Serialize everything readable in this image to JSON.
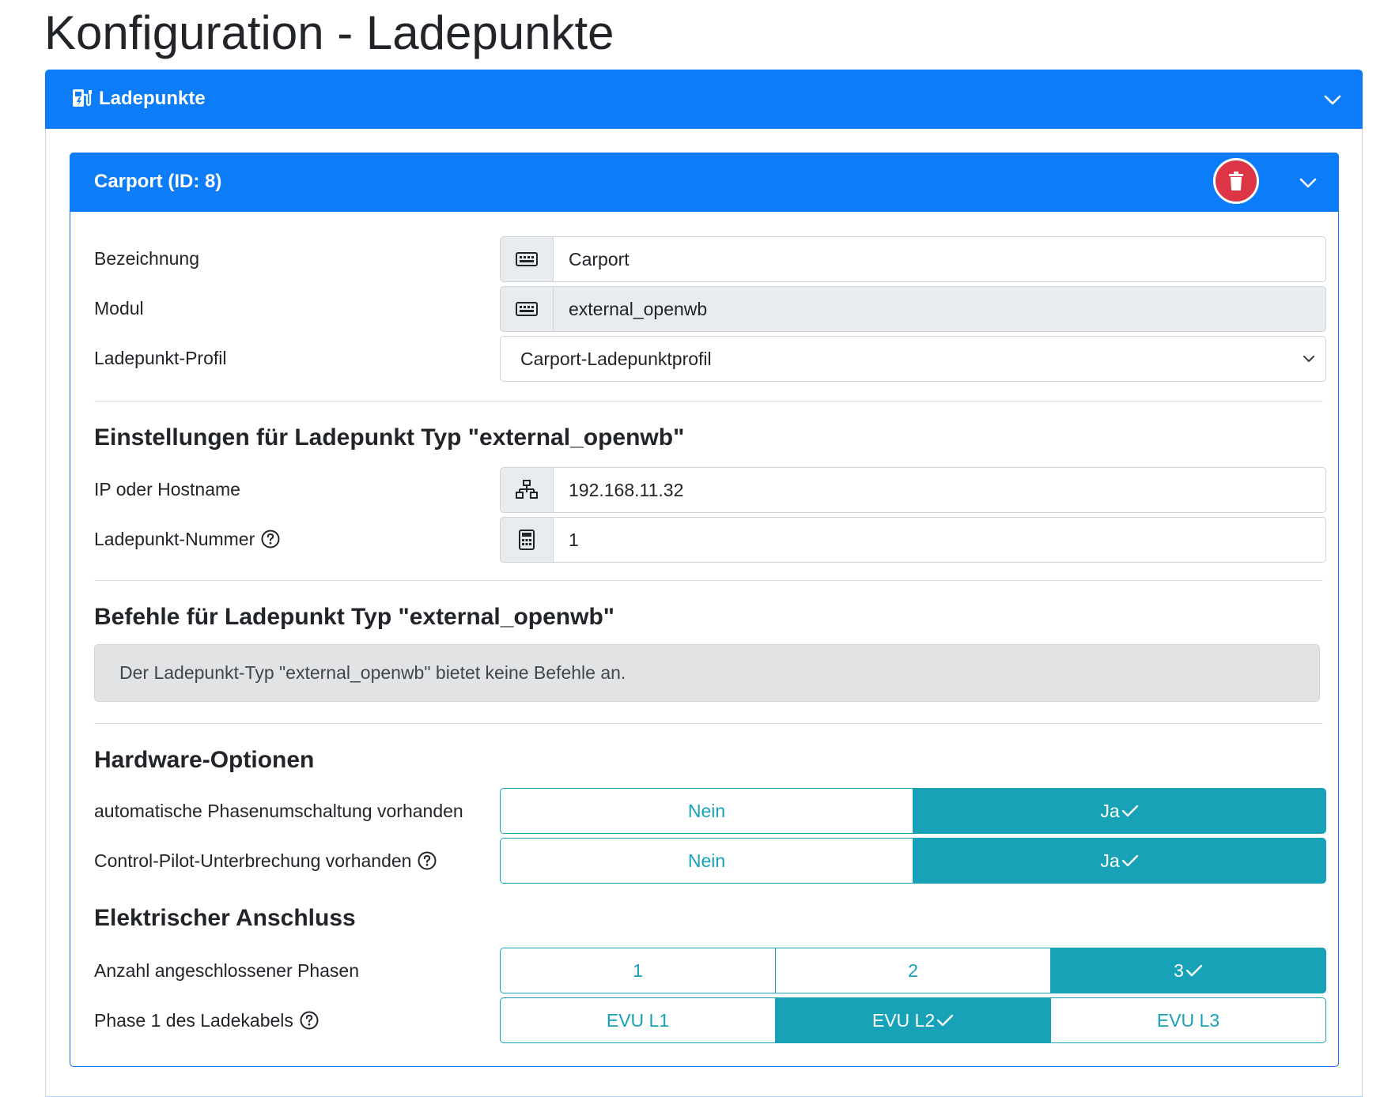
{
  "page": {
    "title": "Konfiguration - Ladepunkte"
  },
  "outer_card": {
    "title": "Ladepunkte",
    "icon": "charging-station-icon"
  },
  "chargepoint": {
    "title": "Carport (ID: 8)",
    "fields": {
      "bezeichnung": {
        "label": "Bezeichnung",
        "value": "Carport",
        "icon": "keyboard-icon"
      },
      "modul": {
        "label": "Modul",
        "value": "external_openwb",
        "icon": "keyboard-icon"
      },
      "profil": {
        "label": "Ladepunkt-Profil",
        "value": "Carport-Ladepunktprofil"
      }
    },
    "settings": {
      "heading": "Einstellungen für Ladepunkt Typ \"external_openwb\"",
      "ip": {
        "label": "IP oder Hostname",
        "value": "192.168.11.32",
        "icon": "network-icon"
      },
      "nummer": {
        "label": "Ladepunkt-Nummer",
        "value": "1",
        "icon": "calculator-icon"
      }
    },
    "commands": {
      "heading": "Befehle für Ladepunkt Typ \"external_openwb\"",
      "message": "Der Ladepunkt-Typ \"external_openwb\" bietet keine Befehle an."
    },
    "hardware": {
      "heading": "Hardware-Optionen",
      "phase_switch": {
        "label": "automatische Phasenumschaltung vorhanden",
        "options": [
          "Nein",
          "Ja"
        ],
        "selected": "Ja"
      },
      "cp_interrupt": {
        "label": "Control-Pilot-Unterbrechung vorhanden",
        "options": [
          "Nein",
          "Ja"
        ],
        "selected": "Ja"
      }
    },
    "electrical": {
      "heading": "Elektrischer Anschluss",
      "phases": {
        "label": "Anzahl angeschlossener Phasen",
        "options": [
          "1",
          "2",
          "3"
        ],
        "selected": "3"
      },
      "phase1": {
        "label": "Phase 1 des Ladekabels",
        "options": [
          "EVU L1",
          "EVU L2",
          "EVU L3"
        ],
        "selected": "EVU L2"
      }
    }
  },
  "colors": {
    "primary": "#0d7cf8",
    "info": "#17a2b8",
    "danger": "#dc3545"
  }
}
